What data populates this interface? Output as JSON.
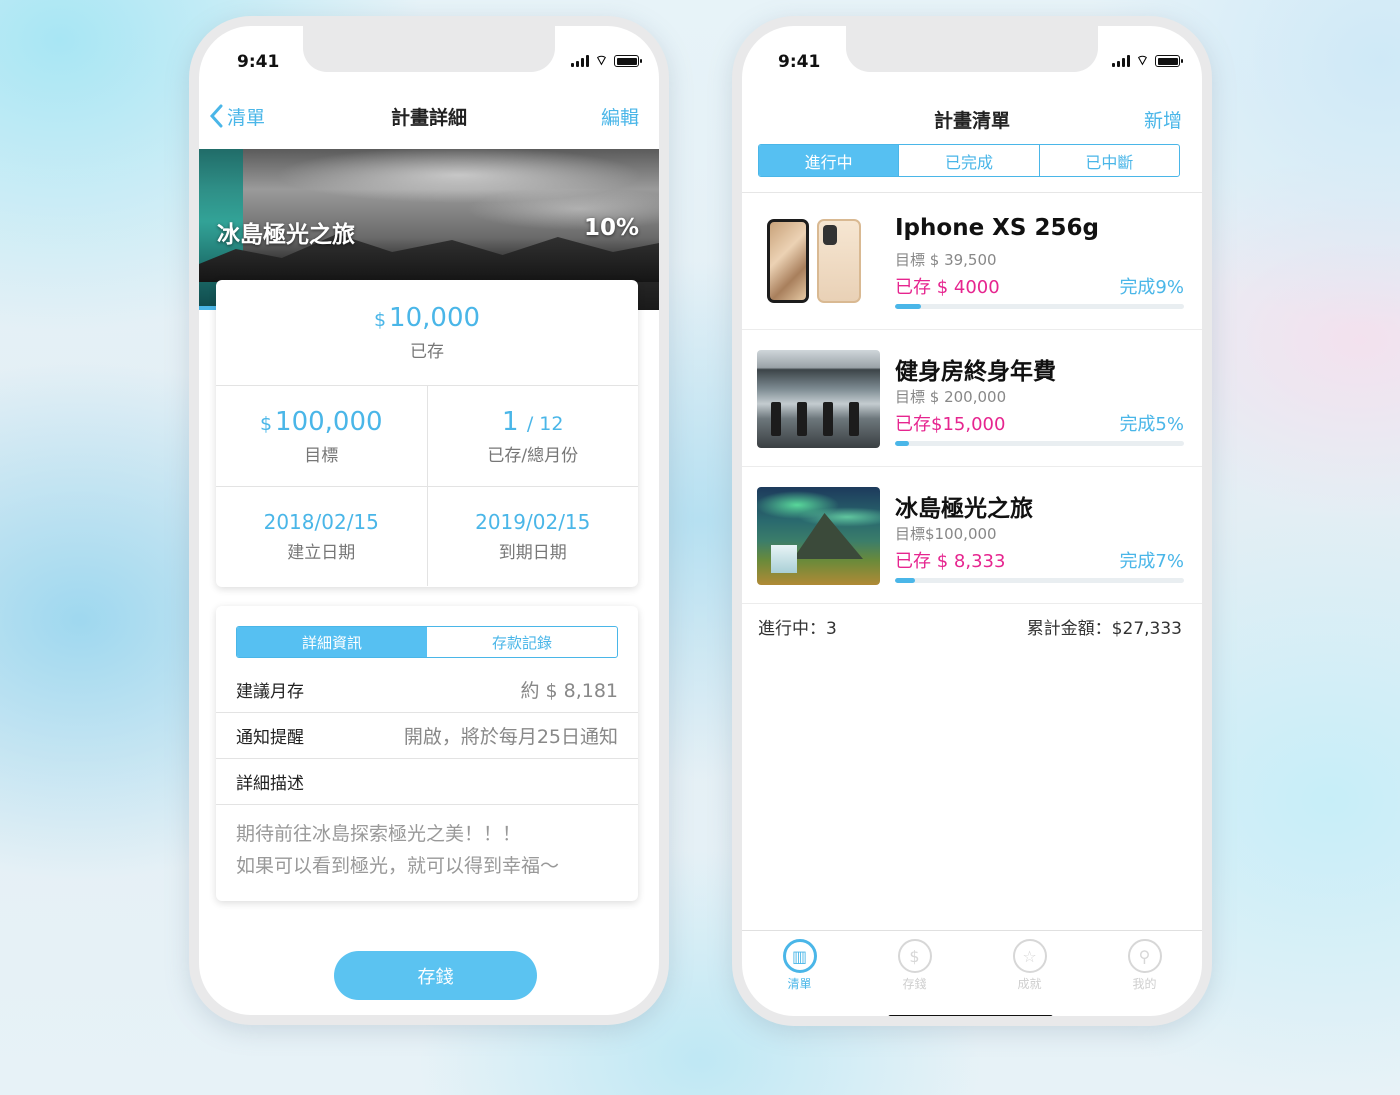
{
  "status": {
    "time": "9:41"
  },
  "detail_screen": {
    "back_label": "清單",
    "title": "計畫詳細",
    "edit_label": "編輯",
    "hero": {
      "title": "冰島極光之旅",
      "percent": "10%"
    },
    "saved": {
      "currency": "$",
      "amount": "10,000",
      "label": "已存"
    },
    "target": {
      "currency": "$",
      "amount": "100,000",
      "label": "目標"
    },
    "months": {
      "done": "1",
      "total": "/ 12",
      "label": "已存/總月份"
    },
    "created": {
      "date": "2018/02/15",
      "label": "建立日期"
    },
    "due": {
      "date": "2019/02/15",
      "label": "到期日期"
    },
    "tabs": [
      "詳細資訊",
      "存款記錄"
    ],
    "rows": [
      {
        "key": "建議月存",
        "value": "約 $ 8,181"
      },
      {
        "key": "通知提醒",
        "value": "開啟，將於每月25日通知"
      },
      {
        "key": "詳細描述",
        "value": ""
      }
    ],
    "description": [
      "期待前往冰島探索極光之美！！！",
      "如果可以看到極光，就可以得到幸福～"
    ],
    "save_button": "存錢"
  },
  "list_screen": {
    "title": "計畫清單",
    "add_label": "新增",
    "tabs": [
      "進行中",
      "已完成",
      "已中斷"
    ],
    "plans": [
      {
        "title": "Iphone XS 256g",
        "target": "目標 $ 39,500",
        "saved": "已存 $ 4000",
        "percent_label": "完成9%",
        "progress": 0.09,
        "thumb": "iphone-xs"
      },
      {
        "title": "健身房終身年費",
        "target": "目標 $ 200,000",
        "saved": "已存$15,000",
        "percent_label": "完成5%",
        "progress": 0.05,
        "thumb": "gym"
      },
      {
        "title": "冰島極光之旅",
        "target": "目標$100,000",
        "saved": "已存 $ 8,333",
        "percent_label": "完成7%",
        "progress": 0.07,
        "thumb": "iceland"
      }
    ],
    "summary": {
      "active": "進行中：3",
      "total": "累計金額：$27,333"
    },
    "tabbar": [
      {
        "label": "清單",
        "icon": "chart-list-icon",
        "active": true
      },
      {
        "label": "存錢",
        "icon": "piggy-bank-icon",
        "active": false
      },
      {
        "label": "成就",
        "icon": "medal-icon",
        "active": false
      },
      {
        "label": "我的",
        "icon": "person-icon",
        "active": false
      }
    ]
  },
  "colors": {
    "accent": "#4ab6e8",
    "saved_pink": "#e6258f"
  }
}
